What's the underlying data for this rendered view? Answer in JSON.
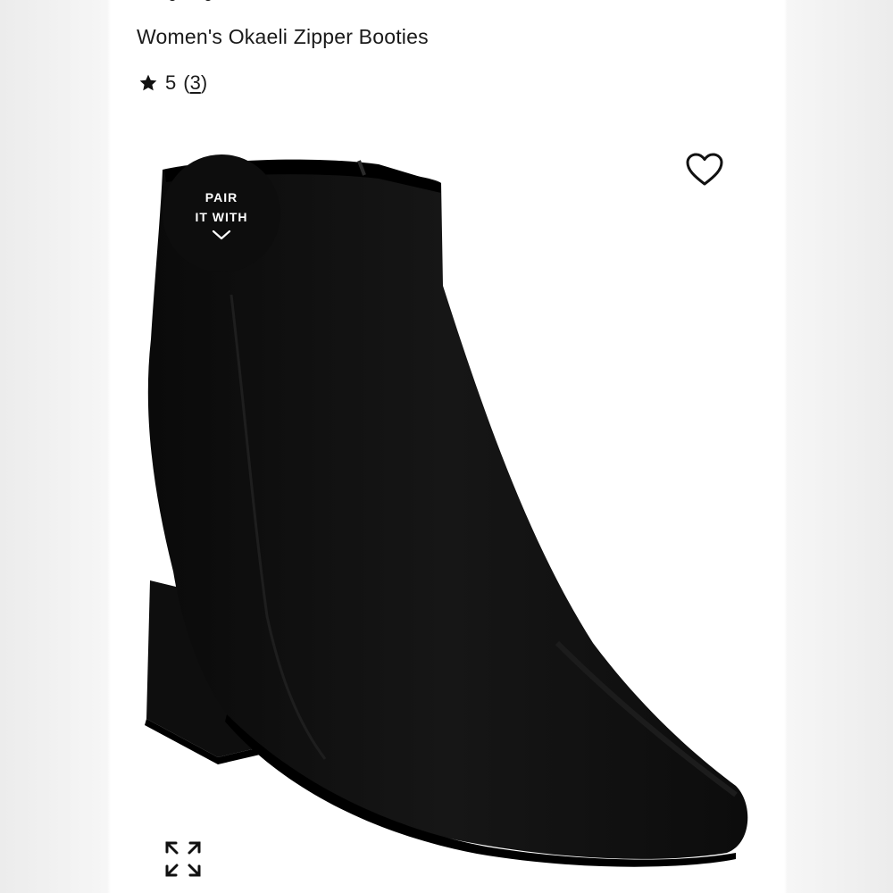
{
  "product": {
    "title": "Women's Okaeli Zipper Booties",
    "rating": {
      "value": "5",
      "open_paren": "(",
      "count": "3",
      "close_paren": ")"
    }
  },
  "badge": {
    "line1": "PAIR",
    "line2": "IT WITH"
  },
  "icons": {
    "star": "star-icon",
    "heart": "heart-icon",
    "chevron": "chevron-down-icon",
    "expand": "expand-icon"
  },
  "colors": {
    "text": "#1a1a1a",
    "badge": "#0d0d0d",
    "boot": "#111111",
    "background": "#ffffff"
  }
}
